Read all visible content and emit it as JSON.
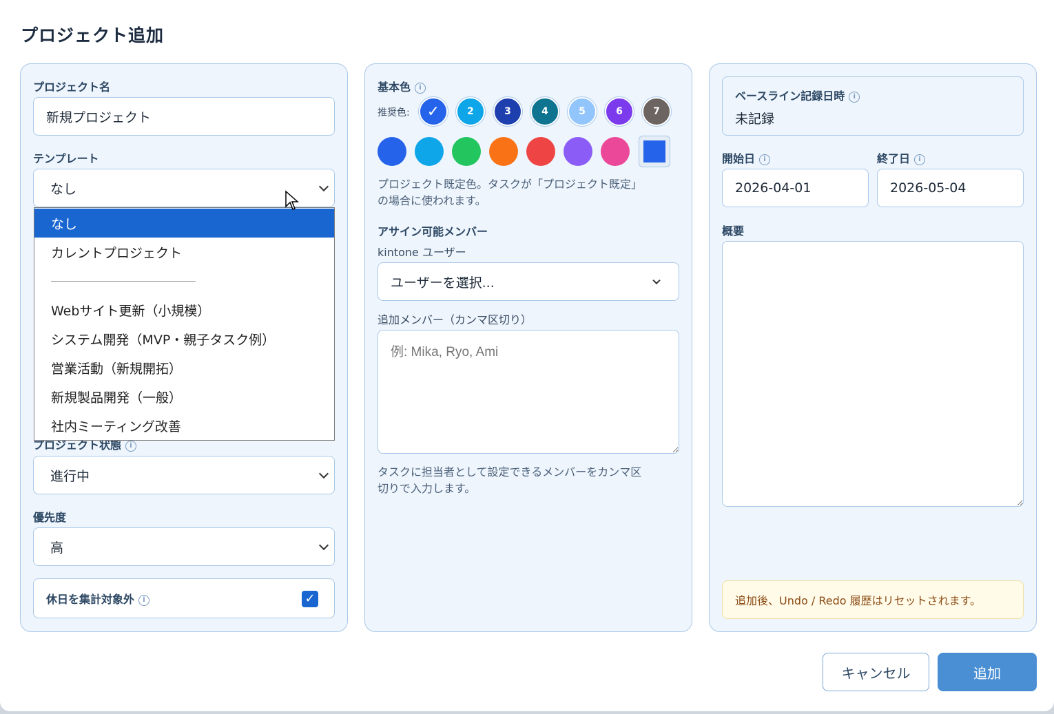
{
  "dialog": {
    "title": "プロジェクト追加"
  },
  "left": {
    "project_name_label": "プロジェクト名",
    "project_name_value": "新規プロジェクト",
    "template_label": "テンプレート",
    "template_value": "なし",
    "template_options": [
      "なし",
      "カレントプロジェクト",
      "Webサイト更新（小規模）",
      "システム開発（MVP・親子タスク例）",
      "営業活動（新規開拓）",
      "新規製品開発（一般）",
      "社内ミーティング改善"
    ],
    "status_label": "プロジェクト状態",
    "status_value": "進行中",
    "priority_label": "優先度",
    "priority_value": "高",
    "holiday_label": "休日を集計対象外",
    "holiday_checked": true,
    "check_glyph": "✓"
  },
  "middle": {
    "base_color_label": "基本色",
    "recommended_label": "推奨色:",
    "recommended_swatches": [
      {
        "text": "✓",
        "color": "#2563eb"
      },
      {
        "text": "2",
        "color": "#0ea5e9"
      },
      {
        "text": "3",
        "color": "#1e40af"
      },
      {
        "text": "4",
        "color": "#0e7490"
      },
      {
        "text": "5",
        "color": "#93c5fd"
      },
      {
        "text": "6",
        "color": "#7c3aed"
      },
      {
        "text": "7",
        "color": "#6b6461"
      }
    ],
    "palette_colors": [
      "#2563eb",
      "#0ea5e9",
      "#22c55e",
      "#f97316",
      "#ef4444",
      "#8b5cf6",
      "#ec4899"
    ],
    "custom_color": "#2563eb",
    "color_hint_line1": "プロジェクト既定色。タスクが「プロジェクト既定」",
    "color_hint_line2": "の場合に使われます。",
    "assignable_label": "アサイン可能メンバー",
    "kintone_label": "kintone ユーザー",
    "user_select_value": "ユーザーを選択...",
    "extra_members_label": "追加メンバー（カンマ区切り）",
    "extra_members_placeholder": "例: Mika, Ryo, Ami",
    "members_hint_line1": "タスクに担当者として設定できるメンバーをカンマ区",
    "members_hint_line2": "切りで入力します。"
  },
  "right": {
    "baseline_label": "ベースライン記録日時",
    "baseline_value": "未記録",
    "start_label": "開始日",
    "start_value": "2026-04-01",
    "end_label": "終了日",
    "end_value": "2026-05-04",
    "summary_label": "概要",
    "notice": "追加後、Undo / Redo 履歴はリセットされます。"
  },
  "footer": {
    "cancel_label": "キャンセル",
    "add_label": "追加"
  },
  "colors": {
    "accent": "#1a66d1",
    "add_button": "#4a8fd4",
    "panel_bg": "#eef5fd",
    "panel_border": "#a9c8e8",
    "notice_bg": "#fffbe8"
  }
}
